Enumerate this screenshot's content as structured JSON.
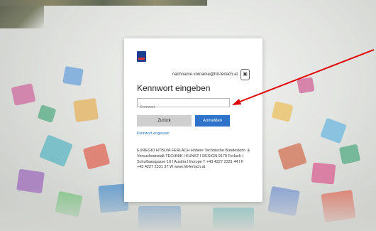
{
  "dialog": {
    "email": "nachname.vorname@htl-ferlach.at",
    "heading": "Kennwort eingeben",
    "password_placeholder": "Kennwort",
    "back_label": "Zurück",
    "login_label": "Anmelden",
    "forgot_label": "Kennwort vergessen",
    "info_text": "EUREGIO HTBLVA FERLACH Höhere Technische Bundeslehr- & Versuchsanstalt TECHNIK I KUNST I DESIGN 9170 Ferlach I Schulhausgasse 10 I Austria I Europe T +43 4227 2331 44 I F +43 4227 2331 37 W www.htl-ferlach.at"
  },
  "icons": {
    "school_logo": "school-logo-icon",
    "user_avatar": "user-badge-icon"
  },
  "colors": {
    "primary_button": "#2e73c9",
    "secondary_button": "#cfcfcf",
    "link": "#1a6fcf",
    "annotation_arrow": "#e00000"
  }
}
